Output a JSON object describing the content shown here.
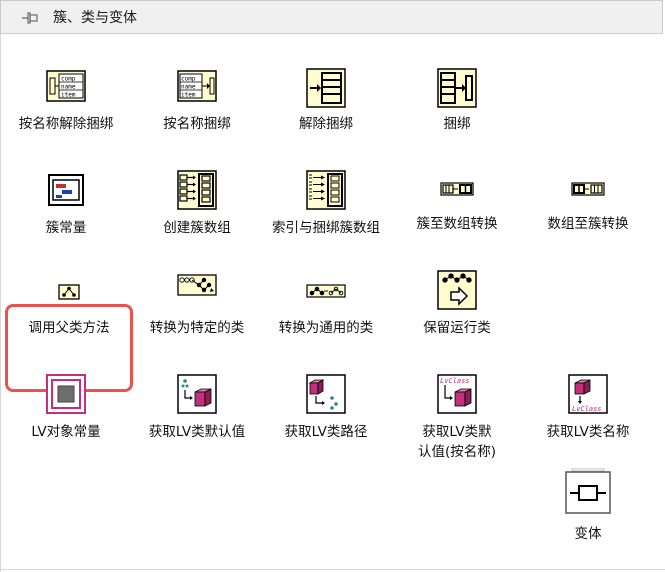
{
  "window": {
    "title": "簇、类与变体",
    "pin_icon": "pin-icon"
  },
  "items": [
    {
      "label": "按名称解除捆绑",
      "icon": "unbundle-by-name-icon",
      "icon_text": [
        "comp",
        "name",
        "item"
      ]
    },
    {
      "label": "按名称捆绑",
      "icon": "bundle-by-name-icon",
      "icon_text": [
        "comp",
        "name",
        "item"
      ]
    },
    {
      "label": "解除捆绑",
      "icon": "unbundle-icon"
    },
    {
      "label": "捆绑",
      "icon": "bundle-icon"
    },
    {
      "label": "簇常量",
      "icon": "cluster-constant-icon"
    },
    {
      "label": "创建簇数组",
      "icon": "build-cluster-array-icon"
    },
    {
      "label": "索引与捆绑簇数组",
      "icon": "index-bundle-cluster-array-icon"
    },
    {
      "label": "簇至数组转换",
      "icon": "cluster-to-array-icon"
    },
    {
      "label": "数组至簇转换",
      "icon": "array-to-cluster-icon"
    },
    {
      "label": "调用父类方法",
      "icon": "call-parent-method-icon"
    },
    {
      "label": "转换为特定的类",
      "icon": "to-more-specific-class-icon"
    },
    {
      "label": "转换为通用的类",
      "icon": "to-more-generic-class-icon"
    },
    {
      "label": "保留运行类",
      "icon": "preserve-runtime-class-icon"
    },
    {
      "label": "LV对象常量",
      "icon": "lv-object-constant-icon"
    },
    {
      "label": "获取LV类默认值",
      "icon": "get-lv-class-default-value-icon"
    },
    {
      "label": "获取LV类路径",
      "icon": "get-lv-class-path-icon"
    },
    {
      "label": "获取LV类默认值(按名称)",
      "icon": "get-lv-class-default-value-by-name-icon",
      "icon_text": [
        "LvClass"
      ]
    },
    {
      "label": "获取LV类名称",
      "icon": "get-lv-class-name-icon",
      "icon_text": [
        "LvClass"
      ]
    },
    {
      "label": "变体",
      "icon": "variant-icon"
    }
  ],
  "highlighted_item": "调用父类方法",
  "colors": {
    "icon_fill": "#fffdd0",
    "highlight": "#e8534f",
    "class_cube": "#c0307c",
    "titlebar": "#f0f0f0"
  }
}
